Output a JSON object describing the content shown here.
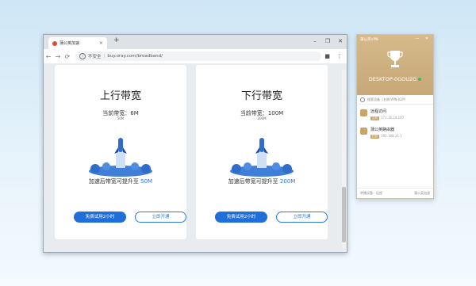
{
  "browser": {
    "tab_title": "蒲公英加速",
    "tab_close": "×",
    "new_tab": "+",
    "win_minimize": "–",
    "win_restore": "❐",
    "win_close": "✕",
    "nav": {
      "back": "←",
      "forward": "→",
      "reload": "⟳"
    },
    "address": {
      "security": "不安全",
      "url": "buy.oray.com/broadband/"
    }
  },
  "cards": [
    {
      "title": "上行带宽",
      "current_label": "当前带宽：6M",
      "current_sub": "50M",
      "after_prefix": "加速后带宽可提升至 ",
      "after_value": "50M",
      "trial_label": "免费试用2小时",
      "open_label": "立即开通"
    },
    {
      "title": "下行带宽",
      "current_label": "当前带宽：100M",
      "current_sub": "200M",
      "after_prefix": "加速后带宽可提升至 ",
      "after_value": "200M",
      "trial_label": "免费试用2小时",
      "open_label": "立即开通"
    }
  ],
  "vpn": {
    "title": "蒲公英VPN",
    "controls": "— ✕",
    "device": "DESKTOP-0GOU2G",
    "search_placeholder": "搜索设备（名称/VPN IG/P）",
    "items": [
      {
        "name": "远程访问",
        "tag": "主机",
        "ip": "172.16.24.107"
      },
      {
        "name": "蒲公英路由器",
        "tag": "在线",
        "ip": "192.168.21.1"
      }
    ],
    "footer_left": "转播设备：远程",
    "footer_right": "蒲公英加速"
  },
  "colors": {
    "accent": "#1e6fd9",
    "vpn_gold": "#c9a46b"
  }
}
